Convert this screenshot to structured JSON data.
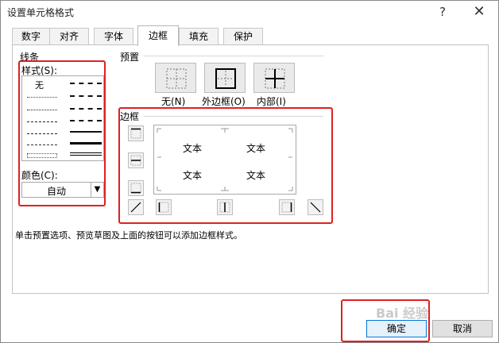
{
  "window": {
    "title": "设置单元格格式",
    "help": "?",
    "close": "✕"
  },
  "tabs": [
    "数字",
    "对齐",
    "字体",
    "边框",
    "填充",
    "保护"
  ],
  "active_tab": "边框",
  "line_group": {
    "title": "线条",
    "style_label": "样式(S):",
    "none_label": "无",
    "color_label": "颜色(C):",
    "color_value": "自动"
  },
  "preset_group": {
    "title": "预置",
    "none": "无(N)",
    "outline": "外边框(O)",
    "inside": "内部(I)"
  },
  "border_group": {
    "title": "边框",
    "preview_text": [
      "文本",
      "文本",
      "文本",
      "文本"
    ]
  },
  "hint": "单击预置选项、预览草图及上面的按钮可以添加边框样式。",
  "buttons": {
    "ok": "确定",
    "cancel": "取消"
  },
  "watermark": "Bai 经验",
  "colors": {
    "highlight": "#e02020",
    "primary_border": "#0078d7"
  }
}
